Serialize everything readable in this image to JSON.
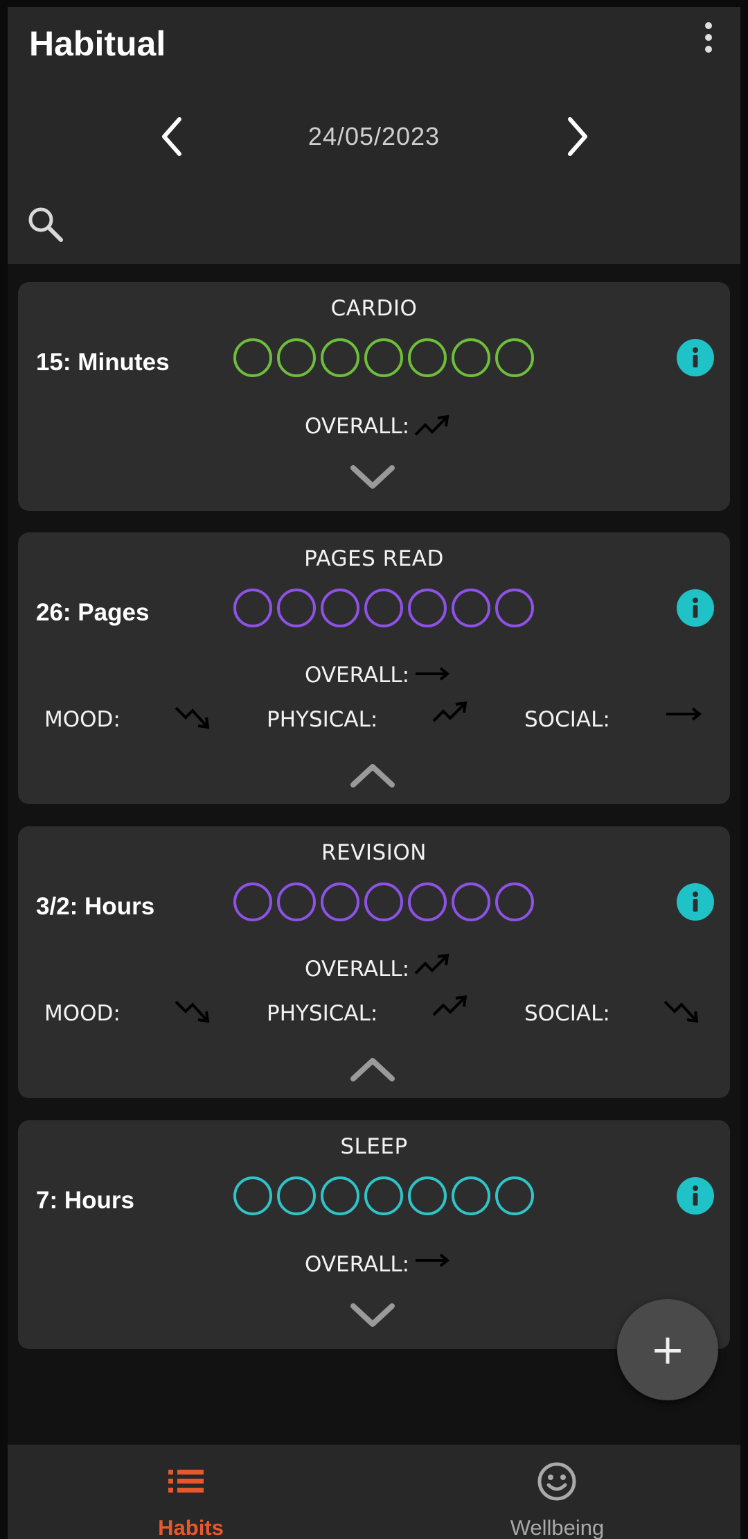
{
  "app": {
    "title": "Habitual"
  },
  "date_nav": {
    "date": "24/05/2023"
  },
  "colors": {
    "green": "#6dbf3b",
    "purple": "#8e52e6",
    "teal": "#2fc4c7",
    "accent": "#e8582c",
    "info": "#1fc2c6"
  },
  "habits": [
    {
      "title": "CARDIO",
      "target": "15: Minutes",
      "circle_color": "green",
      "overall_label": "OVERALL:",
      "overall_trend": "trending-up-icon",
      "expanded": false
    },
    {
      "title": "PAGES READ",
      "target": "26: Pages",
      "circle_color": "purple",
      "overall_label": "OVERALL:",
      "overall_trend": "trending-flat-icon",
      "expanded": true,
      "factors": [
        {
          "label": "MOOD:",
          "trend": "trending-down-icon"
        },
        {
          "label": "PHYSICAL:",
          "trend": "trending-up-icon"
        },
        {
          "label": "SOCIAL:",
          "trend": "trending-flat-icon"
        }
      ]
    },
    {
      "title": "REVISION",
      "target": "3/2: Hours",
      "circle_color": "purple",
      "overall_label": "OVERALL:",
      "overall_trend": "trending-up-icon",
      "expanded": true,
      "factors": [
        {
          "label": "MOOD:",
          "trend": "trending-down-icon"
        },
        {
          "label": "PHYSICAL:",
          "trend": "trending-up-icon"
        },
        {
          "label": "SOCIAL:",
          "trend": "trending-down-icon"
        }
      ]
    },
    {
      "title": "SLEEP",
      "target": "7: Hours",
      "circle_color": "teal",
      "overall_label": "OVERALL:",
      "overall_trend": "trending-flat-icon",
      "expanded": false
    }
  ],
  "fab": {
    "symbol": "+",
    "icon": "add-icon"
  },
  "bottom_nav": {
    "tabs": [
      {
        "label": "Habits",
        "icon": "list-icon",
        "active": true
      },
      {
        "label": "Wellbeing",
        "icon": "smiley-icon",
        "active": false
      }
    ]
  }
}
